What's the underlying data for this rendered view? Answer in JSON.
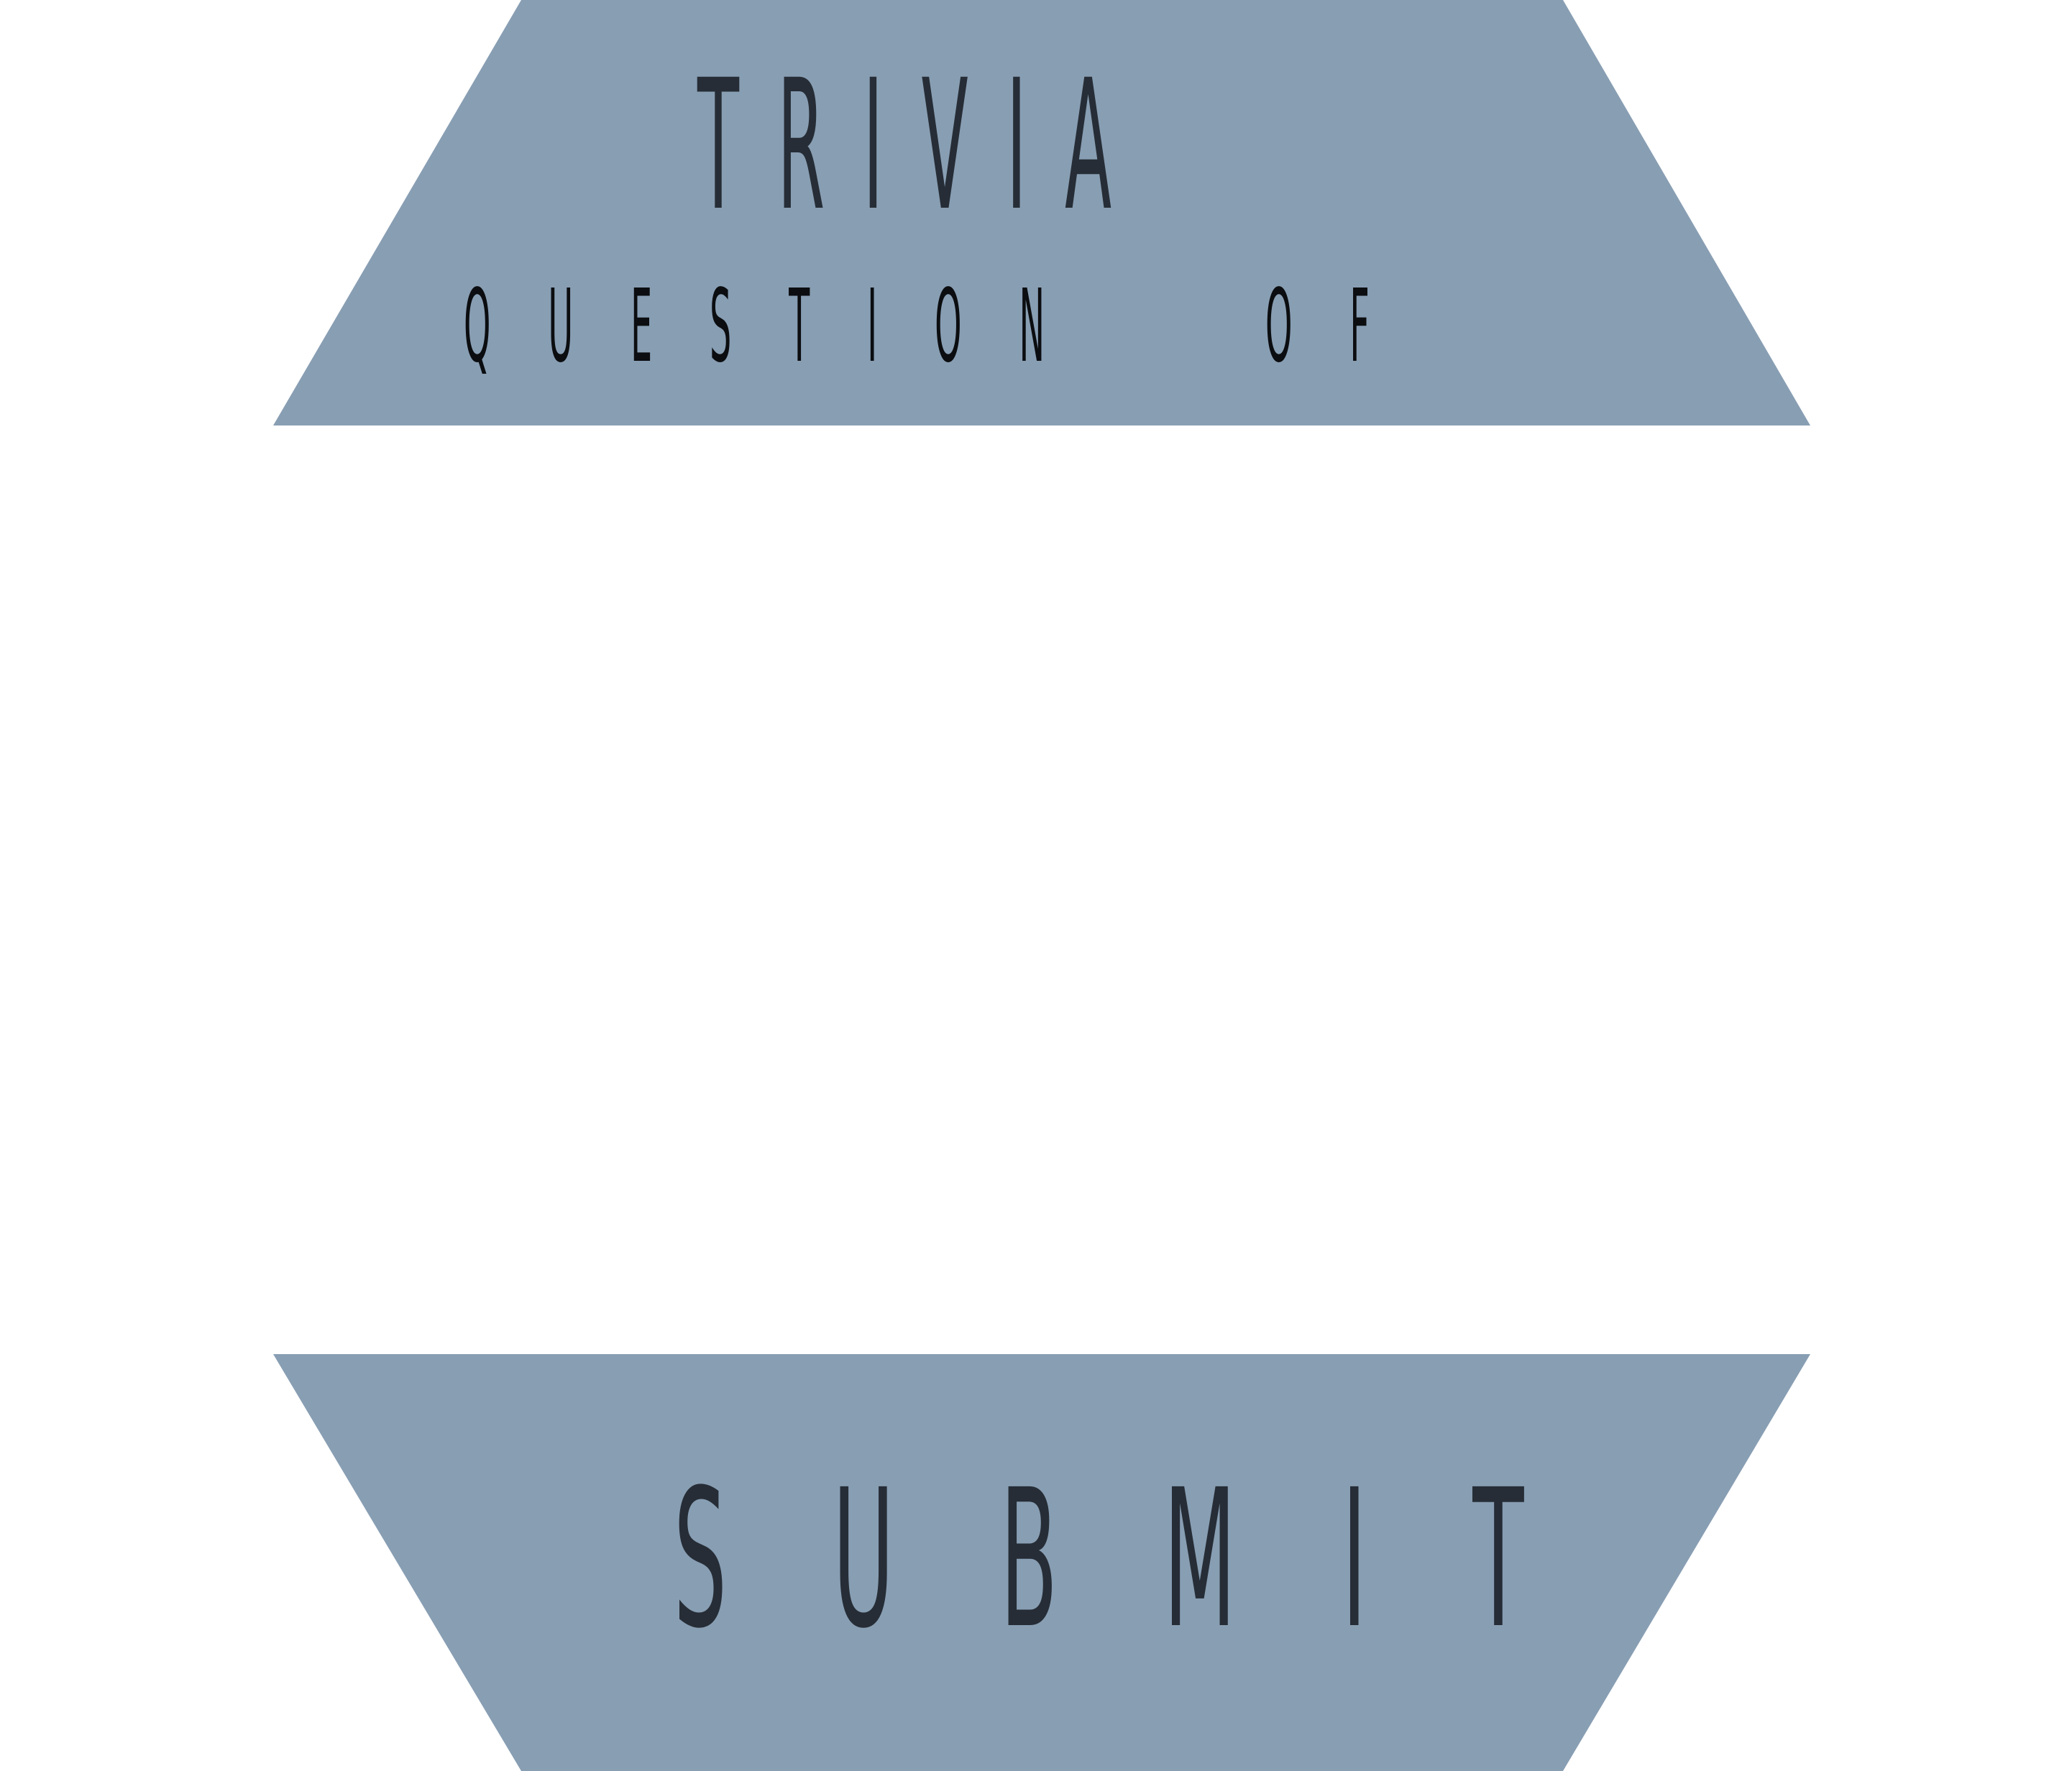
{
  "colors": {
    "panel": "#889eb3",
    "text_dark": "#262d36",
    "text_black": "#0b0d10",
    "background": "#ffffff"
  },
  "header": {
    "title": "TRIVIA",
    "question_label": "QUESTION",
    "of_label": "OF"
  },
  "question": {
    "text": ""
  },
  "footer": {
    "submit_label": "SUBMIT"
  }
}
